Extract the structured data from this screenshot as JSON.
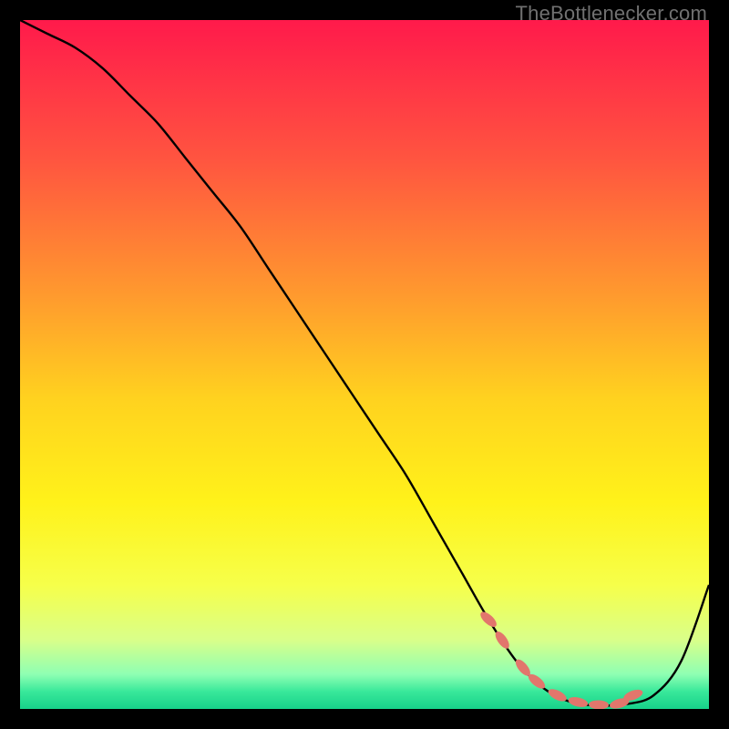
{
  "watermark": "TheBottlenecker.com",
  "chart_data": {
    "type": "line",
    "title": "",
    "xlabel": "",
    "ylabel": "",
    "xlim": [
      0,
      100
    ],
    "ylim": [
      0,
      100
    ],
    "grid": false,
    "legend": false,
    "background_gradient": {
      "stops": [
        {
          "offset": 0.0,
          "color": "#ff1a4b"
        },
        {
          "offset": 0.2,
          "color": "#ff5440"
        },
        {
          "offset": 0.4,
          "color": "#ff9a2e"
        },
        {
          "offset": 0.55,
          "color": "#ffd21f"
        },
        {
          "offset": 0.7,
          "color": "#fff21a"
        },
        {
          "offset": 0.82,
          "color": "#f6ff4a"
        },
        {
          "offset": 0.9,
          "color": "#d9ff8a"
        },
        {
          "offset": 0.95,
          "color": "#8effb3"
        },
        {
          "offset": 0.975,
          "color": "#38e89a"
        },
        {
          "offset": 1.0,
          "color": "#17d18a"
        }
      ]
    },
    "series": [
      {
        "name": "bottleneck-curve",
        "x": [
          0,
          4,
          8,
          12,
          16,
          20,
          24,
          28,
          32,
          36,
          40,
          44,
          48,
          52,
          56,
          60,
          64,
          68,
          72,
          76,
          80,
          84,
          88,
          92,
          96,
          100
        ],
        "y": [
          100,
          98,
          96,
          93,
          89,
          85,
          80,
          75,
          70,
          64,
          58,
          52,
          46,
          40,
          34,
          27,
          20,
          13,
          7,
          3,
          1,
          0.5,
          0.7,
          2,
          7,
          18
        ]
      }
    ],
    "markers": {
      "name": "highlight-dots",
      "color": "#e2766c",
      "x": [
        68,
        70,
        73,
        75,
        78,
        81,
        84,
        87,
        89
      ],
      "y": [
        13,
        10,
        6,
        4,
        2,
        1,
        0.6,
        0.8,
        2
      ]
    }
  }
}
